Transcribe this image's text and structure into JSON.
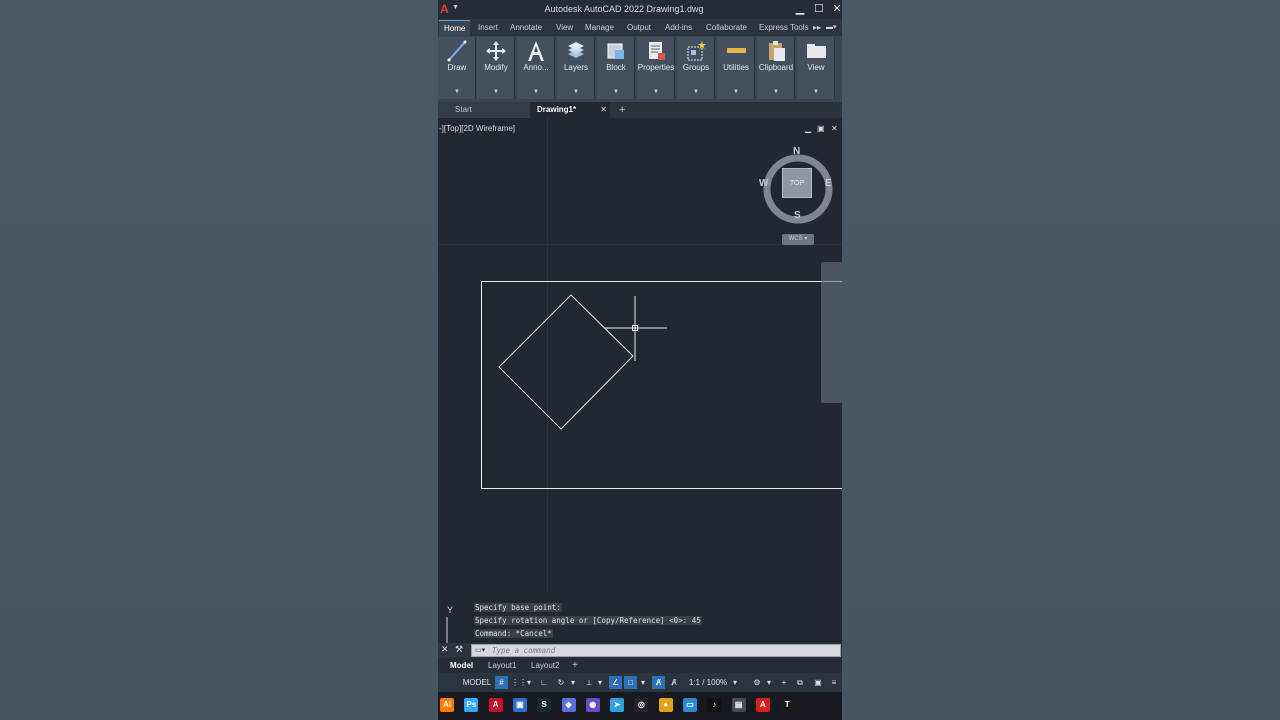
{
  "window": {
    "title": "Autodesk AutoCAD 2022   Drawing1.dwg",
    "app_logo": "A",
    "minimize": "▁",
    "maximize": "☐",
    "close": "✕"
  },
  "ribbon_tabs": [
    "Home",
    "Insert",
    "Annotate",
    "View",
    "Manage",
    "Output",
    "Add-ins",
    "Collaborate",
    "Express Tools"
  ],
  "ribbon_overflow": "▸▸",
  "ribbon_panels": [
    {
      "label": "Draw",
      "icon": "line-icon"
    },
    {
      "label": "Modify",
      "icon": "move-icon"
    },
    {
      "label": "Anno...",
      "icon": "text-icon"
    },
    {
      "label": "Layers",
      "icon": "layers-icon"
    },
    {
      "label": "Block",
      "icon": "block-icon"
    },
    {
      "label": "Properties",
      "icon": "properties-icon"
    },
    {
      "label": "Groups",
      "icon": "groups-icon"
    },
    {
      "label": "Utilities",
      "icon": "measure-icon"
    },
    {
      "label": "Clipboard",
      "icon": "clipboard-icon"
    },
    {
      "label": "View",
      "icon": "view-icon"
    }
  ],
  "doc_tabs": {
    "start": "Start",
    "active": "Drawing1*",
    "close": "✕",
    "add": "+"
  },
  "viewport": {
    "label": "-][Top][2D Wireframe]",
    "controls": [
      "▁",
      "▣",
      "✕"
    ],
    "viewcube": {
      "n": "N",
      "s": "S",
      "e": "E",
      "w": "W",
      "face": "TOP",
      "wcs": "WCS ▾"
    }
  },
  "command_history": [
    "Specify base point:",
    "Specify rotation angle or [Copy/Reference] <0>: 45",
    "Command: *Cancel*"
  ],
  "command_input": {
    "placeholder": "Type a command",
    "value": ""
  },
  "ucs": {
    "y_label": "Y"
  },
  "layout_tabs": [
    "Model",
    "Layout1",
    "Layout2"
  ],
  "layout_add": "+",
  "status_bar": {
    "model": "MODEL",
    "scale": "1:1 / 100%"
  },
  "taskbar_icons": [
    {
      "label": "Ai",
      "color": "#ff7c00"
    },
    {
      "label": "Ps",
      "color": "#31a8ff"
    },
    {
      "label": "A",
      "color": "#c8102e"
    },
    {
      "label": "▣",
      "color": "#2c6fd1"
    },
    {
      "label": "S",
      "color": "#1b2838"
    },
    {
      "label": "◆",
      "color": "#5a6ee0"
    },
    {
      "label": "◉",
      "color": "#6b49c8"
    },
    {
      "label": "➤",
      "color": "#2aa3e0"
    },
    {
      "label": "◎",
      "color": "#202428"
    },
    {
      "label": "●",
      "color": "#e3a21a"
    },
    {
      "label": "▭",
      "color": "#2c89d6"
    },
    {
      "label": "♪",
      "color": "#111111"
    },
    {
      "label": "▤",
      "color": "#444c56"
    },
    {
      "label": "A",
      "color": "#d81e1e"
    },
    {
      "label": "T",
      "color": "#1a1a1a"
    }
  ],
  "colors": {
    "accent": "#5aa3e6",
    "canvas": "#212830",
    "ribbon": "#3b4553"
  }
}
